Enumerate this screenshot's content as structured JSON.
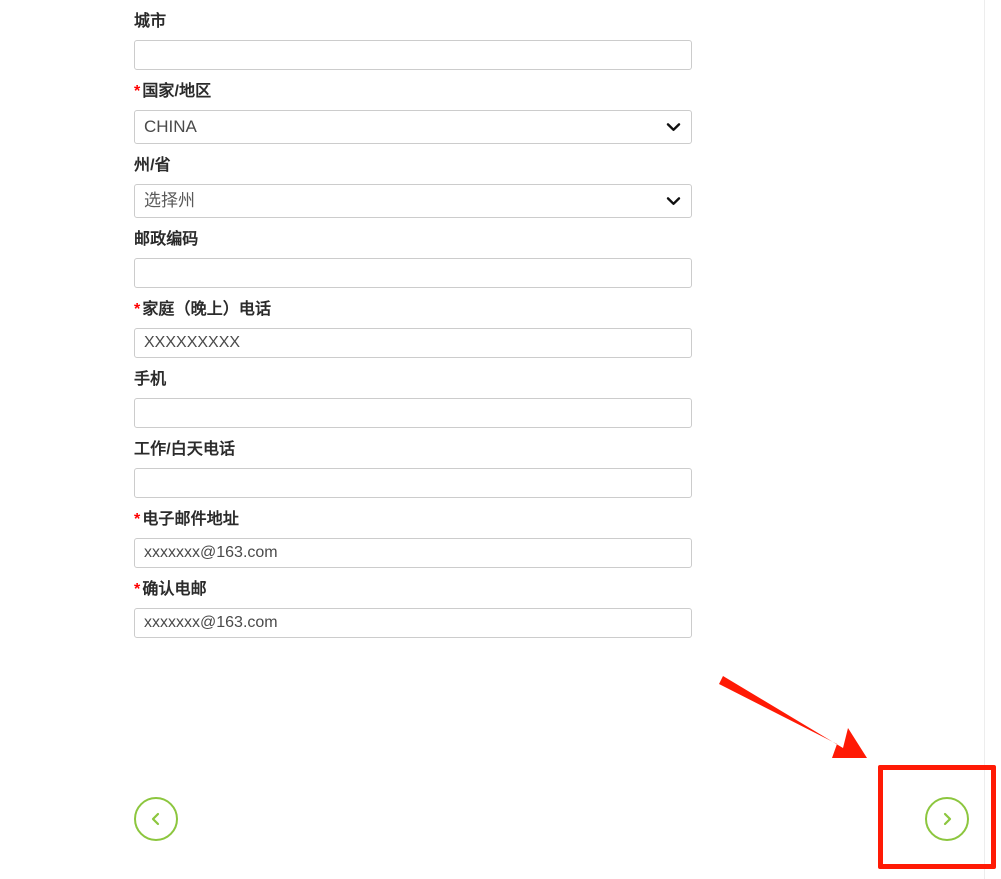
{
  "page": {
    "background_color": "#ffffff",
    "label_color": "#2b2b2b",
    "required_marker_color": "#ff0000",
    "input_border_color": "#cccccc",
    "accent_green": "#8cc63e",
    "annotation_red": "#ff1a05"
  },
  "form": {
    "fields": [
      {
        "name": "city",
        "label": "城市",
        "required": false,
        "required_marker": "",
        "type": "text",
        "value": "",
        "placeholder": ""
      },
      {
        "name": "country-region",
        "label": "国家/地区",
        "required": true,
        "required_marker": "*",
        "type": "select",
        "value": "CHINA",
        "placeholder": ""
      },
      {
        "name": "state-province",
        "label": "州/省",
        "required": false,
        "required_marker": "",
        "type": "select",
        "value": "",
        "placeholder": "选择州"
      },
      {
        "name": "postal-code",
        "label": "邮政编码",
        "required": false,
        "required_marker": "",
        "type": "text",
        "value": "",
        "placeholder": ""
      },
      {
        "name": "home-evening-phone",
        "label": "家庭（晚上）电话",
        "required": true,
        "required_marker": "*",
        "type": "text",
        "value": "XXXXXXXXX",
        "placeholder": ""
      },
      {
        "name": "mobile-phone",
        "label": "手机",
        "required": false,
        "required_marker": "",
        "type": "text",
        "value": "",
        "placeholder": ""
      },
      {
        "name": "work-daytime-phone",
        "label": "工作/白天电话",
        "required": false,
        "required_marker": "",
        "type": "text",
        "value": "",
        "placeholder": ""
      },
      {
        "name": "email-address",
        "label": "电子邮件地址",
        "required": true,
        "required_marker": "*",
        "type": "text",
        "value": "xxxxxxx@163.com",
        "placeholder": ""
      },
      {
        "name": "confirm-email",
        "label": "确认电邮",
        "required": true,
        "required_marker": "*",
        "type": "text",
        "value": "xxxxxxx@163.com",
        "placeholder": ""
      }
    ]
  },
  "navigation": {
    "previous": {
      "icon": "chevron-left-icon",
      "label": ""
    },
    "next": {
      "icon": "chevron-right-icon",
      "label": ""
    }
  },
  "annotations": {
    "highlight_box": {
      "name": "next-button-highlight",
      "color": "#ff1a05"
    },
    "arrow": {
      "name": "pointer-arrow",
      "color": "#ff1a05",
      "direction": "down-right"
    }
  },
  "icons": {
    "select_chevron": "chevron-down-icon"
  }
}
